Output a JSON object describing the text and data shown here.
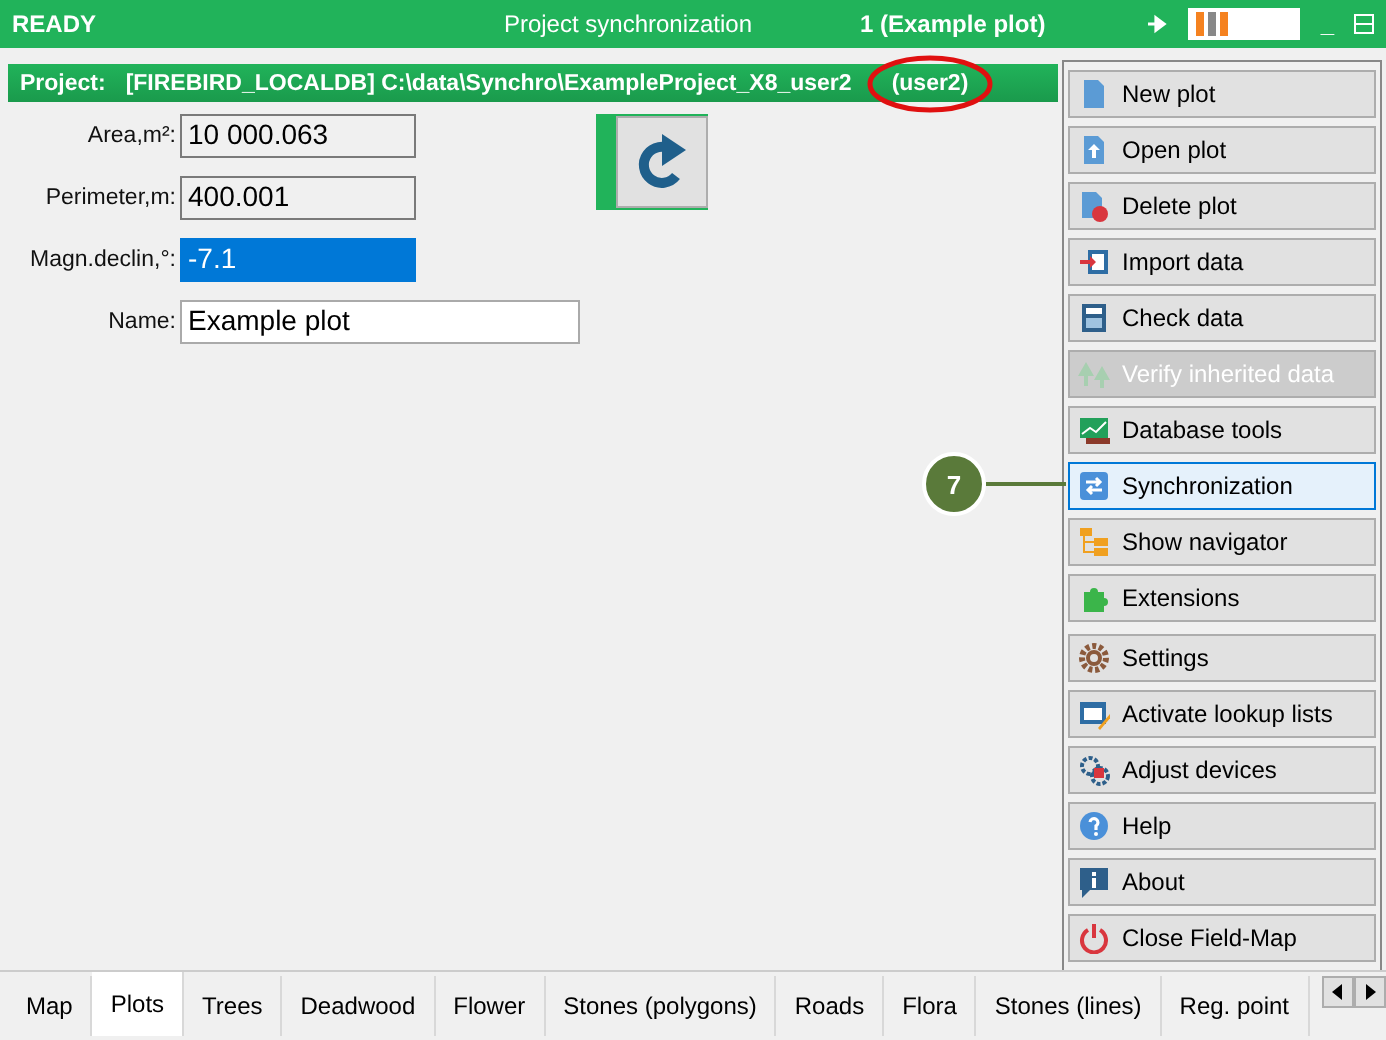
{
  "title_bar": {
    "status": "READY",
    "title": "Project synchronization",
    "plot": "1 (Example plot)",
    "minimize": "_"
  },
  "project_bar": {
    "label": "Project:",
    "path": "[FIREBIRD_LOCALDB] C:\\data\\Synchro\\ExampleProject_X8_user2",
    "user": "(user2)"
  },
  "fields": [
    {
      "label": "Area,m²:",
      "value": "10 000.063",
      "readonly": true,
      "selected": false
    },
    {
      "label": "Perimeter,m:",
      "value": "400.001",
      "readonly": true,
      "selected": false
    },
    {
      "label": "Magn.declin,°:",
      "value": "-7.1",
      "readonly": false,
      "selected": true
    },
    {
      "label": "Name:",
      "value": "Example plot",
      "readonly": false,
      "selected": false
    }
  ],
  "callout": {
    "number": "7"
  },
  "menu": {
    "groups": [
      [
        {
          "label": "New plot",
          "disabled": false,
          "selected": false
        },
        {
          "label": "Open plot",
          "disabled": false,
          "selected": false
        },
        {
          "label": "Delete plot",
          "disabled": false,
          "selected": false
        },
        {
          "label": "Import data",
          "disabled": false,
          "selected": false
        },
        {
          "label": "Check data",
          "disabled": false,
          "selected": false
        },
        {
          "label": "Verify inherited data",
          "disabled": true,
          "selected": false
        },
        {
          "label": "Database tools",
          "disabled": false,
          "selected": false
        },
        {
          "label": "Synchronization",
          "disabled": false,
          "selected": true
        },
        {
          "label": "Show navigator",
          "disabled": false,
          "selected": false
        },
        {
          "label": "Extensions",
          "disabled": false,
          "selected": false
        }
      ],
      [
        {
          "label": "Settings",
          "disabled": false,
          "selected": false
        },
        {
          "label": "Activate lookup lists",
          "disabled": false,
          "selected": false
        },
        {
          "label": "Adjust devices",
          "disabled": false,
          "selected": false
        },
        {
          "label": "Help",
          "disabled": false,
          "selected": false
        },
        {
          "label": "About",
          "disabled": false,
          "selected": false
        },
        {
          "label": "Close Field-Map",
          "disabled": false,
          "selected": false
        }
      ]
    ]
  },
  "tabs": [
    {
      "label": "Map",
      "selected": false
    },
    {
      "label": "Plots",
      "selected": true
    },
    {
      "label": "Trees",
      "selected": false
    },
    {
      "label": "Deadwood",
      "selected": false
    },
    {
      "label": "Flower",
      "selected": false
    },
    {
      "label": "Stones (polygons)",
      "selected": false
    },
    {
      "label": "Roads",
      "selected": false
    },
    {
      "label": "Flora",
      "selected": false
    },
    {
      "label": "Stones (lines)",
      "selected": false
    },
    {
      "label": "Reg. point",
      "selected": false
    }
  ]
}
